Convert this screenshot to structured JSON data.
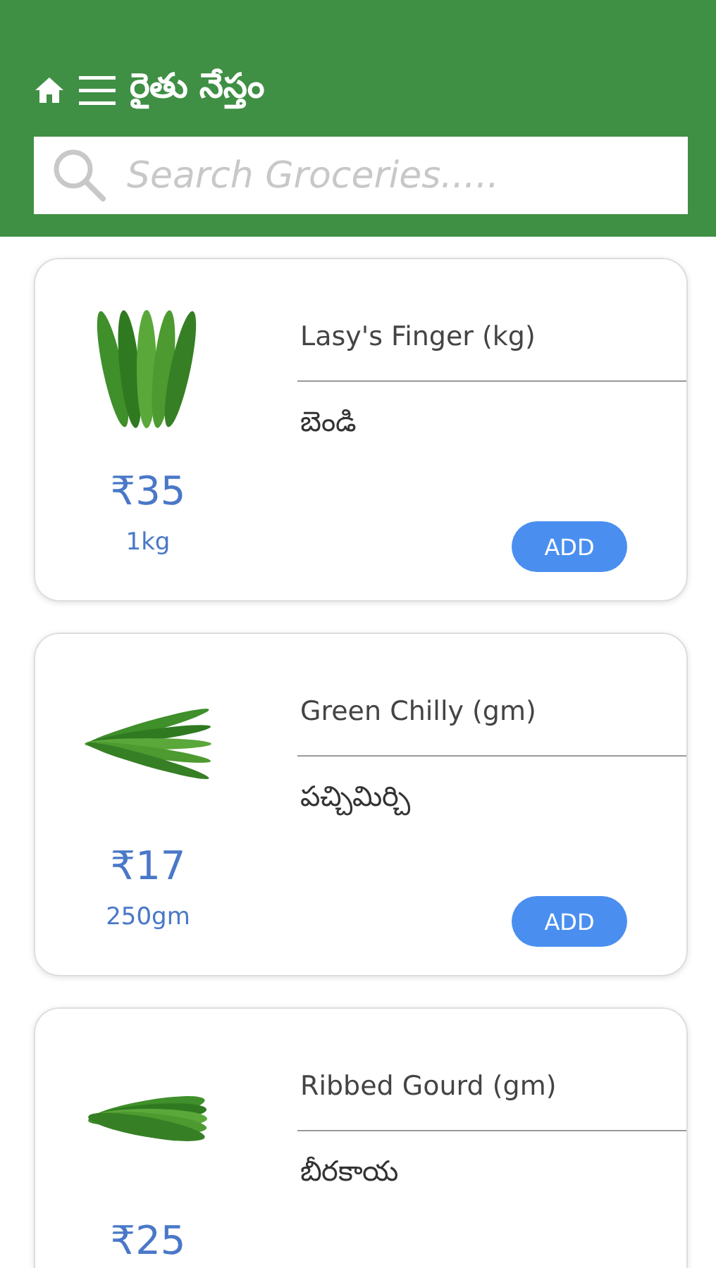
{
  "header": {
    "title": "రైతు నేస్తం"
  },
  "search": {
    "placeholder": "Search Groceries....."
  },
  "products": [
    {
      "name": "Lasy's Finger (kg)",
      "local_name": "బెండి",
      "price": "₹35",
      "unit": "1kg",
      "button": "ADD"
    },
    {
      "name": "Green Chilly (gm)",
      "local_name": "పచ్చిమిర్చి",
      "price": "₹17",
      "unit": "250gm",
      "button": "ADD"
    },
    {
      "name": "Ribbed Gourd (gm)",
      "local_name": "బీరకాయ",
      "price": "₹25"
    }
  ]
}
